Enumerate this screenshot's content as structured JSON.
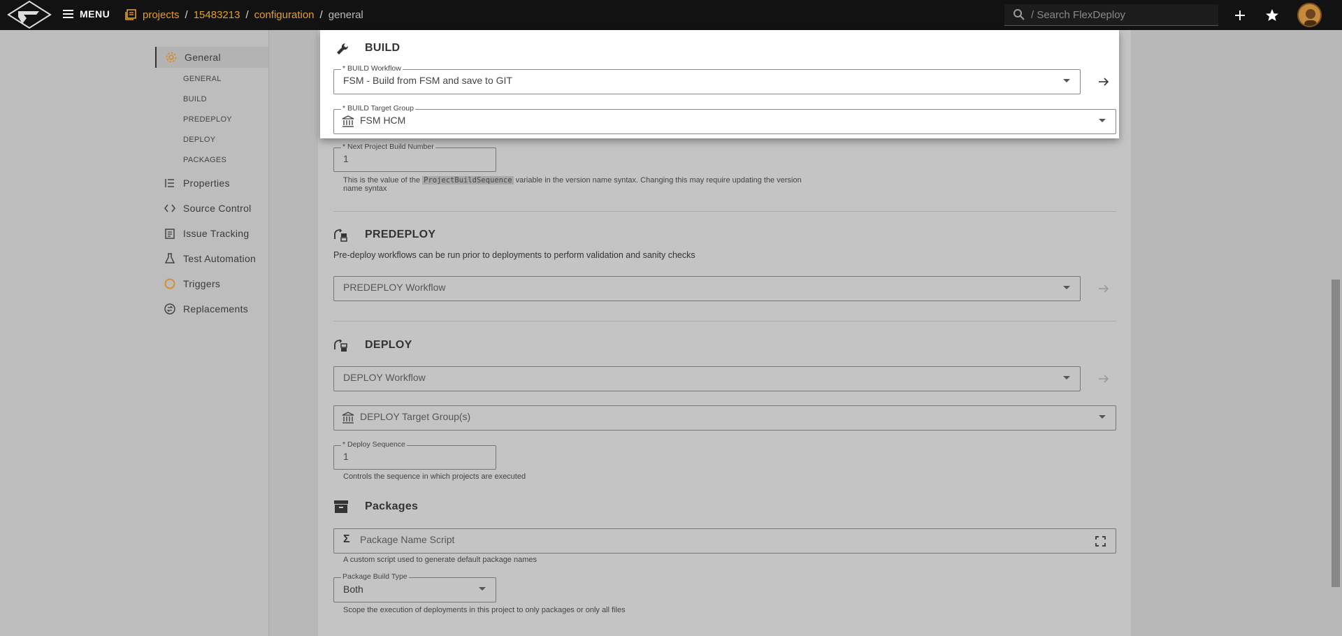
{
  "topbar": {
    "menu_label": "MENU",
    "breadcrumb": [
      "projects",
      "15483213",
      "configuration",
      "general"
    ],
    "search_placeholder": "/ Search FlexDeploy"
  },
  "sidebar": {
    "items": [
      {
        "label": "General",
        "icon": "gear-icon",
        "active": true
      },
      {
        "label": "Properties",
        "icon": "list-icon"
      },
      {
        "label": "Source Control",
        "icon": "code-icon"
      },
      {
        "label": "Issue Tracking",
        "icon": "clipboard-icon"
      },
      {
        "label": "Test Automation",
        "icon": "flask-icon"
      },
      {
        "label": "Triggers",
        "icon": "circle-icon"
      },
      {
        "label": "Replacements",
        "icon": "swap-icon"
      }
    ],
    "sub_items": [
      "GENERAL",
      "BUILD",
      "PREDEPLOY",
      "DEPLOY",
      "PACKAGES"
    ]
  },
  "build": {
    "title": "BUILD",
    "workflow_label": "* BUILD Workflow",
    "workflow_value": "FSM - Build from FSM and save to GIT",
    "target_label": "* BUILD Target Group",
    "target_value": "FSM HCM"
  },
  "build_number": {
    "label": "* Next Project Build Number",
    "value": "1",
    "hint_pre": "This is the value of the",
    "hint_code": "ProjectBuildSequence",
    "hint_post": "variable in the version name syntax. Changing this may require updating the version",
    "hint_line2": "name syntax"
  },
  "predeploy": {
    "title": "PREDEPLOY",
    "description": "Pre-deploy workflows can be run prior to deployments to perform validation and sanity checks",
    "workflow_placeholder": "PREDEPLOY Workflow"
  },
  "deploy": {
    "title": "DEPLOY",
    "workflow_placeholder": "DEPLOY Workflow",
    "target_placeholder": "DEPLOY Target Group(s)",
    "sequence_label": "* Deploy Sequence",
    "sequence_value": "1",
    "sequence_hint": "Controls the sequence in which projects are executed"
  },
  "packages": {
    "title": "Packages",
    "script_placeholder": "Package Name Script",
    "script_hint": "A custom script used to generate default package names",
    "build_type_label": "Package Build Type",
    "build_type_value": "Both",
    "build_type_hint": "Scope the execution of deployments in this project to only packages or only all files"
  },
  "colors": {
    "accent": "#e59e27",
    "topbar": "#121212",
    "overlay": "#b8b8b8"
  }
}
